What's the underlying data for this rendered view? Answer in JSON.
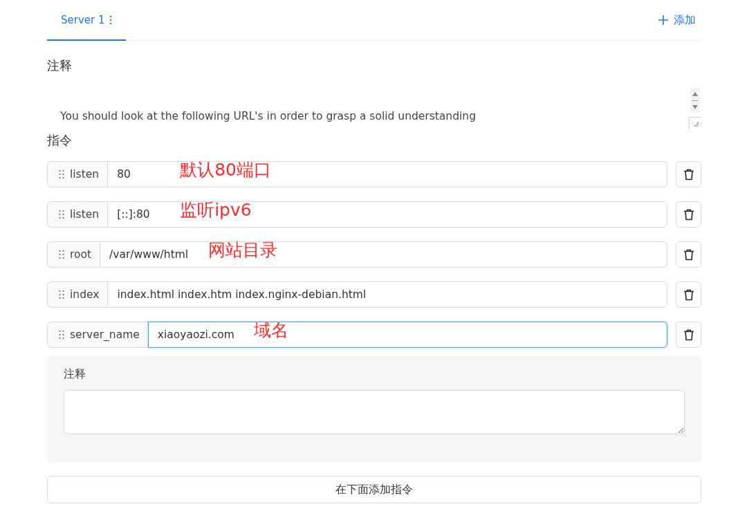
{
  "tabs": [
    {
      "label": "Server 1",
      "selected": true
    }
  ],
  "add_button": {
    "label": "添加"
  },
  "comment": {
    "heading": "注释",
    "value": "You should look at the following URL's in order to grasp a solid understanding"
  },
  "directives_heading": "指令",
  "directives": [
    {
      "name": "listen",
      "value": "80",
      "focused": false,
      "annotation": "默认80端口"
    },
    {
      "name": "listen",
      "value": "[::]:80",
      "focused": false,
      "annotation": "监听ipv6"
    },
    {
      "name": "root",
      "value": "/var/www/html",
      "focused": false,
      "annotation": "网站目录"
    },
    {
      "name": "index",
      "value": "index.html index.htm index.nginx-debian.html",
      "focused": false
    },
    {
      "name": "server_name",
      "value": "xiaoyaozi.com",
      "focused": true,
      "annotation": "域名"
    }
  ],
  "directive_comment": {
    "label": "注释"
  },
  "add_directive_button": "在下面添加指令"
}
